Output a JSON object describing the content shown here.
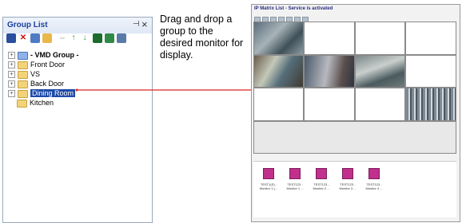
{
  "group_list": {
    "title": "Group List",
    "pin_icon": "pin-icon",
    "close_icon": "close-icon",
    "tree": [
      {
        "label": "- VMD Group -",
        "bold": true,
        "expander": "+",
        "folder_color": "blue"
      },
      {
        "label": "Front Door",
        "expander": "+"
      },
      {
        "label": "VS",
        "expander": "+"
      },
      {
        "label": "Back Door",
        "expander": "+"
      },
      {
        "label": "Dining Room",
        "expander": "+",
        "selected": true
      },
      {
        "label": "Kitchen",
        "expander": ""
      }
    ]
  },
  "instruction": "Drag and drop a group to the desired monitor for display.",
  "matrix_window": {
    "title": "IP Matrix List - Service is activated",
    "monitors": [
      {
        "line1": "TEST1(S) -",
        "line2": "Monitor 1 (..."
      },
      {
        "line1": "TEST123 -",
        "line2": "Monitor 1 ..."
      },
      {
        "line1": "TEST123 -",
        "line2": "Monitor 2 ..."
      },
      {
        "line1": "TEST123 -",
        "line2": "Monitor 3 ..."
      },
      {
        "line1": "TEST123 -",
        "line2": "Monitor 4 ..."
      }
    ]
  },
  "colors": {
    "title_blue": "#1c3f9c",
    "selection": "#1f4aa8",
    "arrow_red": "#e02020",
    "monitor_icon": "#c0308c"
  }
}
